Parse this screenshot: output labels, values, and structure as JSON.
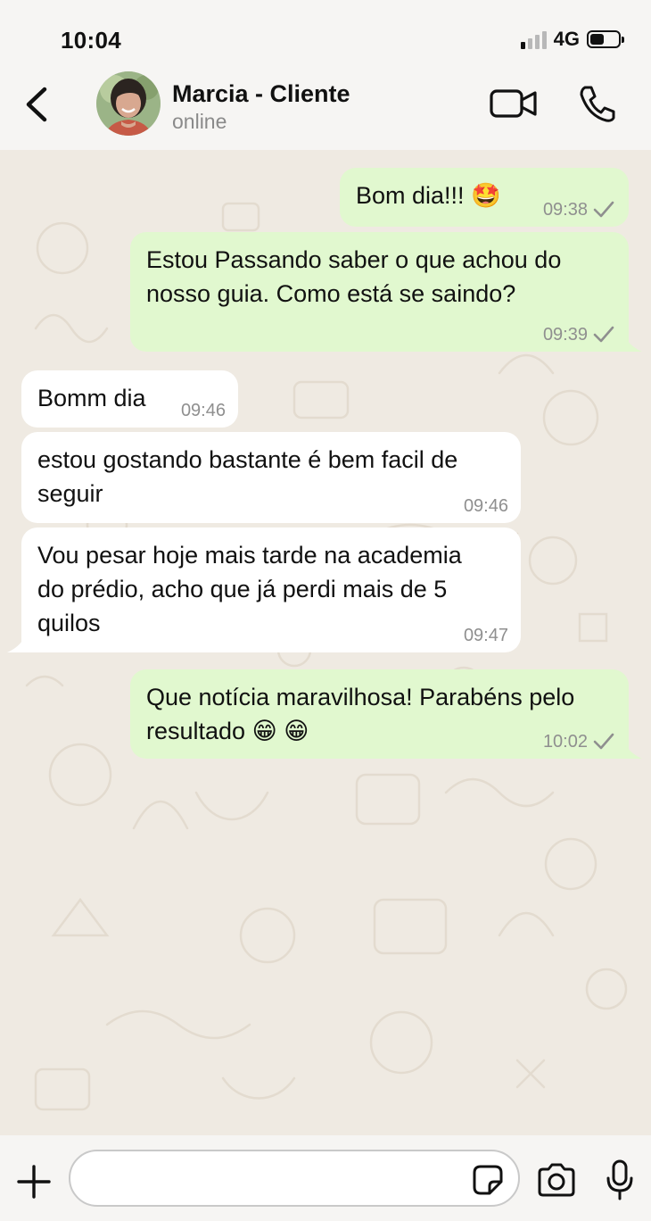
{
  "status_bar": {
    "time": "10:04",
    "network": "4G",
    "signal_bars_active": 1,
    "signal_bars_total": 4,
    "battery_level": 0.45
  },
  "header": {
    "contact_name": "Marcia - Cliente",
    "contact_status": "online",
    "icons": [
      "back-arrow-icon",
      "video-call-icon",
      "phone-icon"
    ]
  },
  "messages": [
    {
      "direction": "out",
      "text": "Bom dia!!! 🤩",
      "time": "09:38",
      "status": "sent"
    },
    {
      "direction": "out",
      "text": "Estou Passando saber o que achou do\nnosso guia. Como está se saindo?",
      "time": "09:39",
      "status": "sent"
    },
    {
      "direction": "in",
      "text": "Bomm dia",
      "time": "09:46"
    },
    {
      "direction": "in",
      "text": "estou gostando bastante é bem facil de\nseguir",
      "time": "09:46"
    },
    {
      "direction": "in",
      "text": "Vou pesar hoje mais tarde na academia\ndo prédio, acho que já perdi mais de 5\nquilos",
      "time": "09:47"
    },
    {
      "direction": "out",
      "text": "Que notícia maravilhosa! Parabéns pelo\nresultado 😁 😁",
      "time": "10:02",
      "status": "sent"
    }
  ],
  "input_bar": {
    "placeholder": "",
    "icons": [
      "plus-icon",
      "sticker-icon",
      "camera-icon",
      "microphone-icon"
    ]
  },
  "colors": {
    "outgoing_bubble": "#e1f8cf",
    "incoming_bubble": "#ffffff",
    "chat_background": "#efeae2",
    "bar_background": "#f6f5f3",
    "meta_text": "#8f8f8f"
  }
}
